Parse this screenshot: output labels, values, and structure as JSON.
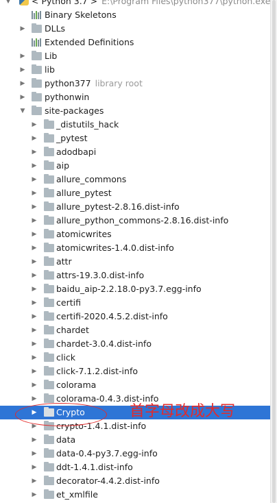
{
  "tree": {
    "root": {
      "label": "< Python 3.7 >",
      "path": "E:\\Program Files\\python377\\python.exe"
    },
    "top_items": [
      {
        "label": "Binary Skeletons",
        "icon": "library-bars-icon",
        "expandable": false
      },
      {
        "label": "DLLs",
        "icon": "folder-icon",
        "expandable": true
      },
      {
        "label": "Extended Definitions",
        "icon": "library-bars-icon",
        "expandable": false
      },
      {
        "label": "Lib",
        "icon": "folder-icon",
        "expandable": true
      },
      {
        "label": "lib",
        "icon": "folder-icon",
        "expandable": true
      },
      {
        "label": "python377",
        "sub": "library root",
        "icon": "folder-icon",
        "expandable": true
      },
      {
        "label": "pythonwin",
        "icon": "folder-icon",
        "expandable": true
      },
      {
        "label": "site-packages",
        "icon": "folder-icon",
        "expandable": true,
        "expanded": true
      }
    ],
    "site_packages": [
      "_distutils_hack",
      "_pytest",
      "adodbapi",
      "aip",
      "allure_commons",
      "allure_pytest",
      "allure_pytest-2.8.16.dist-info",
      "allure_python_commons-2.8.16.dist-info",
      "atomicwrites",
      "atomicwrites-1.4.0.dist-info",
      "attr",
      "attrs-19.3.0.dist-info",
      "baidu_aip-2.2.18.0-py3.7.egg-info",
      "certifi",
      "certifi-2020.4.5.2.dist-info",
      "chardet",
      "chardet-3.0.4.dist-info",
      "click",
      "click-7.1.2.dist-info",
      "colorama",
      "colorama-0.4.3.dist-info",
      "Crypto",
      "crypto-1.4.1.dist-info",
      "data",
      "data-0.4-py3.7.egg-info",
      "ddt-1.4.1.dist-info",
      "decorator-4.4.2.dist-info",
      "et_xmlfile"
    ],
    "selected": "Crypto"
  },
  "annotation": {
    "text": "首字母改成大写",
    "color": "#e22b2b"
  },
  "colors": {
    "selection": "#2e75d6",
    "folder": "#aeb9c0"
  }
}
